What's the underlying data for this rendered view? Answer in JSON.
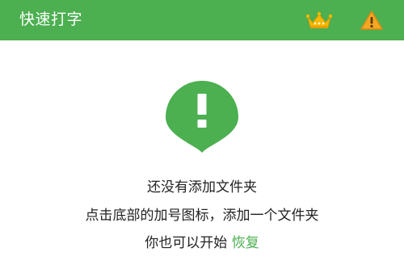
{
  "app_bar": {
    "title": "快速打字",
    "background": "#4caf50",
    "actions": [
      {
        "icon": "crown-icon",
        "color": "#f5b800"
      },
      {
        "icon": "warning-icon",
        "color": "#f5a623"
      }
    ]
  },
  "empty_state": {
    "icon": "alert-pin-icon",
    "icon_color": "#4caf50",
    "line1": "还没有添加文件夹",
    "line2": "点击底部的加号图标，添加一个文件夹",
    "line3_prefix": "你也可以开始",
    "restore_label": "恢复"
  }
}
